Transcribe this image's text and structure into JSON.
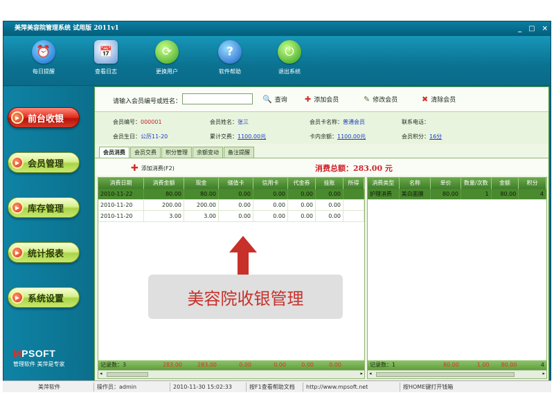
{
  "window": {
    "title": "美萍美容院管理系统 试用版 2011v1",
    "controls": [
      "_",
      "□",
      "×"
    ]
  },
  "toolbar": [
    {
      "label": "每日提醒",
      "icon": "alarm-clock-icon",
      "glyph": "⏰"
    },
    {
      "label": "查看日志",
      "icon": "calendar-log-icon",
      "glyph": "📅"
    },
    {
      "label": "更换用户",
      "icon": "switch-user-icon",
      "glyph": "⟳"
    },
    {
      "label": "软件帮助",
      "icon": "help-icon",
      "glyph": "?"
    },
    {
      "label": "退出系统",
      "icon": "power-icon",
      "glyph": "⏻"
    }
  ],
  "sidebar": {
    "items": [
      {
        "label": "前台收银",
        "active": true
      },
      {
        "label": "会员管理",
        "active": false
      },
      {
        "label": "库存管理",
        "active": false
      },
      {
        "label": "统计报表",
        "active": false
      },
      {
        "label": "系统设置",
        "active": false
      }
    ],
    "brand_logo": "MPSOFT",
    "slogan": "管理软件  美萍是专家"
  },
  "search": {
    "label": "请输入会员编号或姓名：",
    "value": "",
    "query_label": "查询",
    "add_label": "添加会员",
    "edit_label": "修改会员",
    "clear_label": "清除会员"
  },
  "member": {
    "id_label": "会员编号：",
    "id": "000001",
    "name_label": "会员姓名：",
    "name": "张三",
    "card_label": "会员卡名称：",
    "card": "普通会员",
    "phone_label": "联系电话：",
    "phone": "",
    "birthday_label": "会员生日：",
    "birthday": "公历11-20",
    "total_label": "累计交费：",
    "total": "1100.00元",
    "balance_label": "卡内余额：",
    "balance": "1100.00元",
    "points_label": "会员积分：",
    "points": "16分"
  },
  "tabs": [
    "会员消费",
    "会员交费",
    "积分管理",
    "余额变动",
    "备注提醒"
  ],
  "actions": {
    "add_consume": "添加消费(F2)",
    "total_label": "消费总额：",
    "total_value": "283.00 元"
  },
  "left_grid": {
    "headers": [
      "消费日期",
      "消费金额",
      "现金",
      "储值卡",
      "信用卡",
      "代金券",
      "挂账",
      "所得"
    ],
    "rows": [
      [
        "2010-11-22",
        "80.00",
        "80.00",
        "0.00",
        "0.00",
        "0.00",
        "0.00",
        ""
      ],
      [
        "2010-11-20",
        "200.00",
        "200.00",
        "0.00",
        "0.00",
        "0.00",
        "0.00",
        ""
      ],
      [
        "2010-11-20",
        "3.00",
        "3.00",
        "0.00",
        "0.00",
        "0.00",
        "0.00",
        ""
      ]
    ],
    "footer": [
      "记录数：3",
      "283.00",
      "283.00",
      "0.00",
      "0.00",
      "0.00",
      "0.00",
      ""
    ]
  },
  "right_grid": {
    "headers": [
      "消费类型",
      "名称",
      "单价",
      "数量/次数",
      "金额",
      "积分"
    ],
    "rows": [
      [
        "护理消费",
        "美白面膜",
        "80.00",
        "1",
        "80.00",
        "4"
      ]
    ],
    "footer": [
      "记录数：1",
      "",
      "80.00",
      "1.00",
      "80.00",
      "4"
    ]
  },
  "overlay": {
    "caption": "美容院收银管理"
  },
  "statusbar": {
    "app": "美萍软件",
    "operator": "操作员：admin",
    "time": "2010-11-30 15:02:33",
    "help": "按F1查看帮助文档",
    "url": "http://www.mpsoft.net",
    "hint": "按HOME键打开钱箱"
  },
  "colors": {
    "window": "#0b6f8c",
    "accent_red": "#d0202a",
    "grid_header": "#4f8f36",
    "nav_green": "#c8e86d",
    "nav_red": "#e02a1a"
  }
}
